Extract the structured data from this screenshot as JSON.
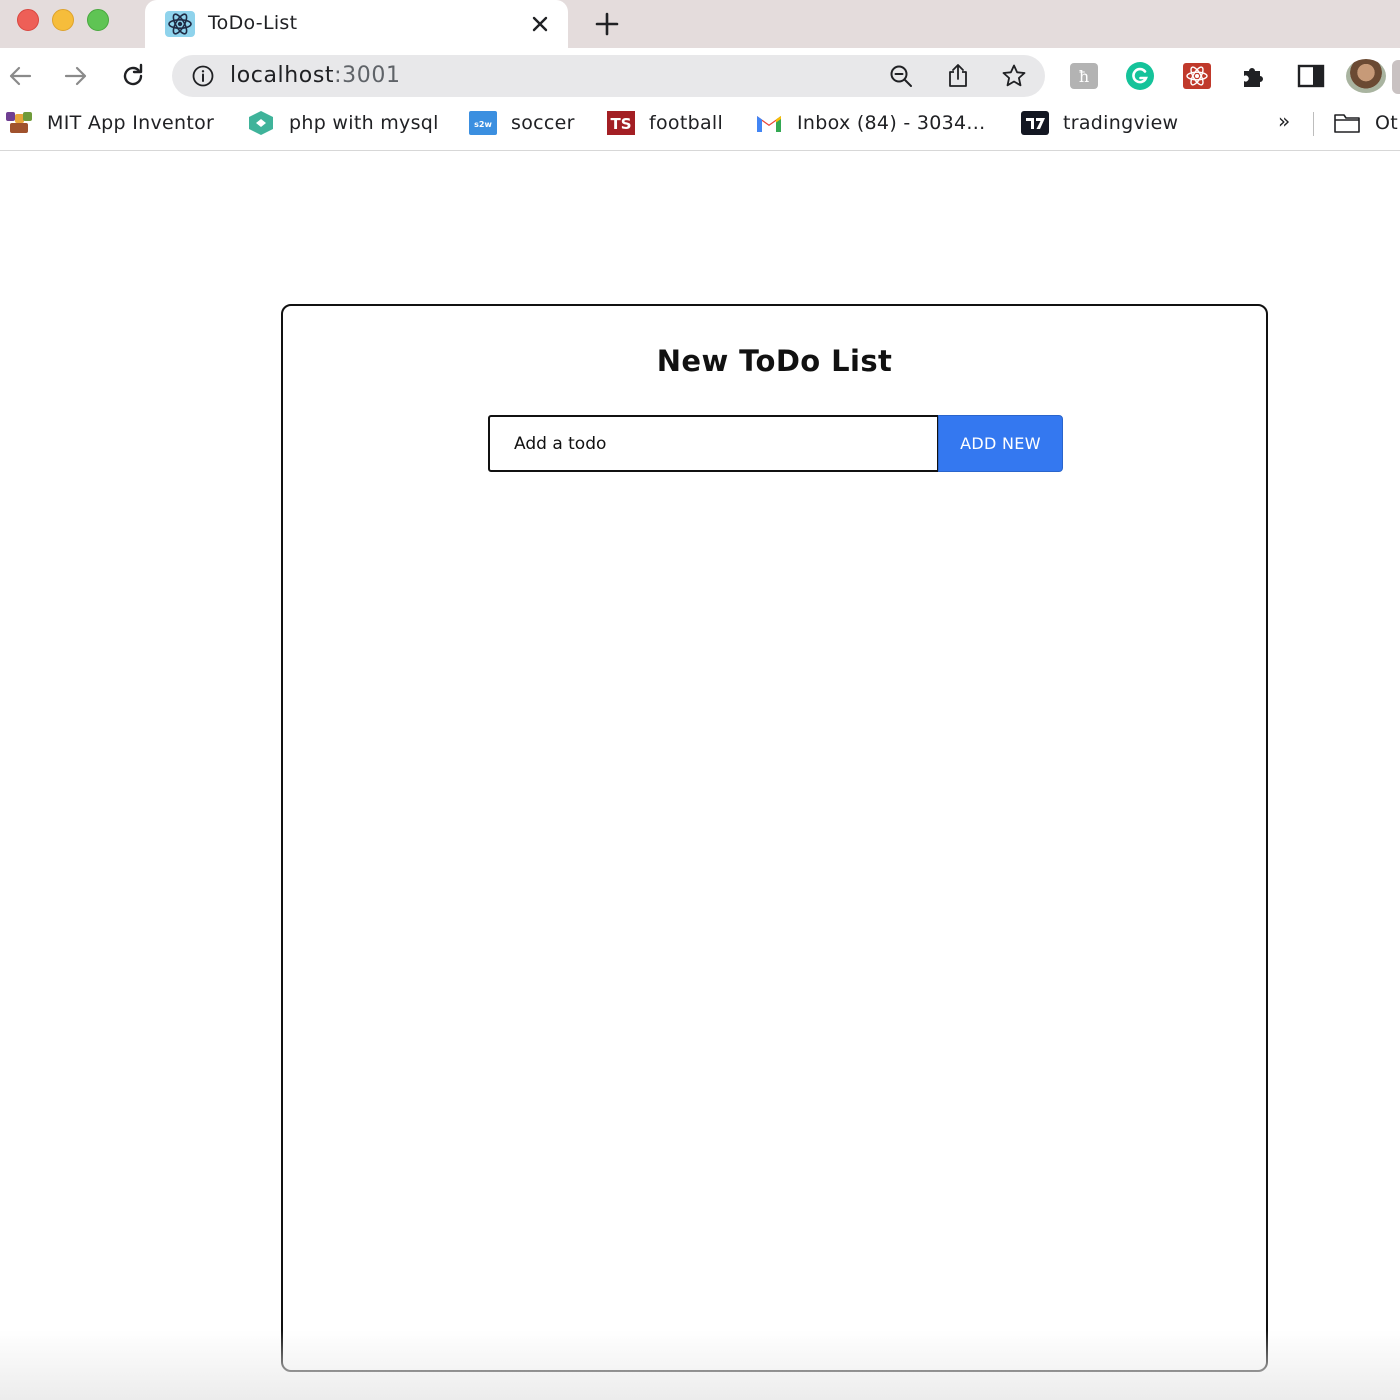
{
  "window": {
    "tab": {
      "title": "ToDo-List",
      "favicon": "react-logo-icon"
    },
    "new_tab_icon": "plus-icon"
  },
  "toolbar": {
    "url_host": "localhost",
    "url_port": ":3001",
    "icons": [
      "back-arrow-icon",
      "forward-arrow-icon",
      "reload-icon",
      "info-icon",
      "zoom-out-icon",
      "share-icon",
      "star-icon"
    ],
    "extensions": [
      "hashnode-extension-icon",
      "grammarly-extension-icon",
      "react-devtools-extension-icon",
      "puzzle-extensions-icon",
      "sidepanel-icon"
    ]
  },
  "bookmarks": {
    "items": [
      {
        "label": "MIT App Inventor",
        "icon": "mit-app-inventor-icon"
      },
      {
        "label": "php with mysql",
        "icon": "php-mysql-icon"
      },
      {
        "label": "soccer",
        "icon": "s2w-icon"
      },
      {
        "label": "football",
        "icon": "ts-icon"
      },
      {
        "label": "Inbox (84) - 3034...",
        "icon": "gmail-icon"
      },
      {
        "label": "tradingview",
        "icon": "tradingview-icon"
      }
    ],
    "overflow": "»",
    "other": "Ot"
  },
  "page": {
    "title": "New ToDo List",
    "input_placeholder": "Add a todo",
    "add_button": "ADD NEW",
    "accent_color": "#3478f0"
  }
}
